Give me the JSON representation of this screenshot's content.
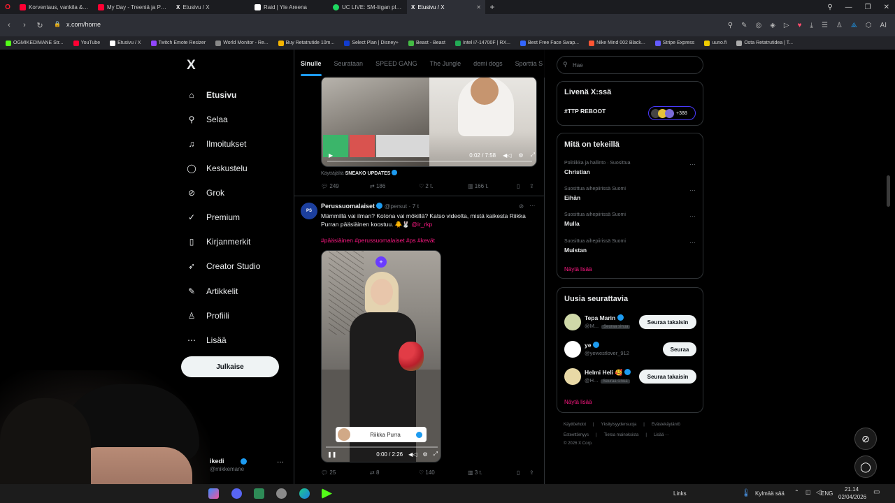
{
  "browser": {
    "tabs": [
      {
        "title": "Korventaus, vankila & tre",
        "color": "#ff0033"
      },
      {
        "title": "My Day - Treeniä ja Paint",
        "color": "#ff0033"
      },
      {
        "title": "Etusivu / X",
        "color": "#ffffff"
      },
      {
        "title": "Raid | Yle Areena",
        "color": "#ffffff"
      },
      {
        "title": "UC LIVE: SM-liigan playoff",
        "color": "#1ed760"
      },
      {
        "title": "Etusivu / X",
        "color": "#ffffff"
      }
    ],
    "url": "x.com/home",
    "bookmarks": [
      {
        "label": "OGMIKEDIMANE Str...",
        "color": "#53fc18"
      },
      {
        "label": "YouTube",
        "color": "#ff0033"
      },
      {
        "label": "Etusivu / X",
        "color": "#ffffff"
      },
      {
        "label": "Twitch Emote Resizer",
        "color": "#9146ff"
      },
      {
        "label": "World Monitor - Re...",
        "color": "#888888"
      },
      {
        "label": "Buy Retatrutide 10m...",
        "color": "#f5b400"
      },
      {
        "label": "Select Plan | Disney+",
        "color": "#113ccf"
      },
      {
        "label": "Beast - Beast",
        "color": "#44bb44"
      },
      {
        "label": "Intel i7-14700F | RX...",
        "color": "#22aa55"
      },
      {
        "label": "Best Free Face Swap...",
        "color": "#3366ff"
      },
      {
        "label": "Nike Mind 002 Black...",
        "color": "#ff5533"
      },
      {
        "label": "Stripe Express",
        "color": "#635bff"
      },
      {
        "label": "uuno.fi",
        "color": "#eecc00"
      },
      {
        "label": "Osta Retatrutidea | T...",
        "color": "#aaaaaa"
      }
    ]
  },
  "sidebar": {
    "logo": "X",
    "items": [
      {
        "label": "Etusivu",
        "icon": "home-icon",
        "glyph": "⌂"
      },
      {
        "label": "Selaa",
        "icon": "search-icon",
        "glyph": "⚲"
      },
      {
        "label": "Ilmoitukset",
        "icon": "bell-icon",
        "glyph": "♫"
      },
      {
        "label": "Keskustelu",
        "icon": "chat-icon",
        "glyph": "◯"
      },
      {
        "label": "Grok",
        "icon": "grok-icon",
        "glyph": "⊘"
      },
      {
        "label": "Premium",
        "icon": "premium-icon",
        "glyph": "✓"
      },
      {
        "label": "Kirjanmerkit",
        "icon": "bookmark-icon",
        "glyph": "▯"
      },
      {
        "label": "Creator Studio",
        "icon": "rocket-icon",
        "glyph": "➶"
      },
      {
        "label": "Artikkelit",
        "icon": "article-icon",
        "glyph": "✎"
      },
      {
        "label": "Profiili",
        "icon": "profile-icon",
        "glyph": "♙"
      },
      {
        "label": "Lisää",
        "icon": "more-icon",
        "glyph": "⋯"
      }
    ],
    "post_button": "Julkaise",
    "account_name": "ikedi",
    "account_handle": "@mikkemane"
  },
  "feed": {
    "tabs": [
      "Sinulle",
      "Seurataan",
      "SPEED GANG",
      "The Jungle",
      "demi dogs",
      "Sporttia S"
    ],
    "tweet1": {
      "video_time": "0:02 / 7:58",
      "via_prefix": "Käyttäjältä",
      "via_name": "SNEAKO UPDATES",
      "replies": "249",
      "retweets": "186",
      "likes": "2 t.",
      "views": "166 t."
    },
    "tweet2": {
      "name": "Perussuomalaiset",
      "handle": "@persut",
      "time": "7 t",
      "text": "Mämmillä vai ilman? Kotona vai mökillä? Katso videolta, mistä kaikesta Riikka Purran pääsiäinen koostuu. 🐥🐰",
      "mention": "@ir_rkp",
      "hashtags": "#pääsiäinen #perussuomalaiset #ps #kevät",
      "lower_third": "Riikka Purra",
      "video_time": "0:00 / 2:26",
      "replies": "25",
      "retweets": "8",
      "likes": "140",
      "views": "3 t."
    }
  },
  "right": {
    "search_placeholder": "Hae",
    "live": {
      "title": "Livenä X:ssä",
      "item": "#TTP REBOOT",
      "count": "+388"
    },
    "trends": {
      "title": "Mitä on tekeillä",
      "items": [
        {
          "cat": "Politiikka ja hallinto · Suosittua",
          "name": "Christian"
        },
        {
          "cat": "Suosittua aihepiirissä Suomi",
          "name": "Eihän"
        },
        {
          "cat": "Suosittua aihepiirissä Suomi",
          "name": "Mulla"
        },
        {
          "cat": "Suosittua aihepiirissä Suomi",
          "name": "Muistan"
        }
      ],
      "show_more": "Näytä lisää"
    },
    "follow": {
      "title": "Uusia seurattavia",
      "users": [
        {
          "name": "Tepa Marin",
          "handle": "@M...",
          "badge": "Seuraa sinua",
          "button": "Seuraa takaisin"
        },
        {
          "name": "ye",
          "handle": "@yewestlover_912",
          "badge": "",
          "button": "Seuraa"
        },
        {
          "name": "Helmi Heli 🥰",
          "handle": "@H...",
          "badge": "Seuraa sinua",
          "button": "Seuraa takaisin"
        }
      ],
      "show_more": "Näytä lisää"
    },
    "footer": {
      "line1": [
        "Käyttöehdot",
        "Yksityisyydensuoja",
        "Evästekäytäntö"
      ],
      "line2": [
        "Esteettömyys",
        "Tietoa mainoksista",
        "Lisää ···"
      ],
      "copyright": "© 2026 X Corp."
    }
  },
  "taskbar": {
    "links": "Links",
    "weather": "Kylmää sää",
    "lang": "ENG",
    "time": "21.14",
    "date": "02/04/2026"
  }
}
